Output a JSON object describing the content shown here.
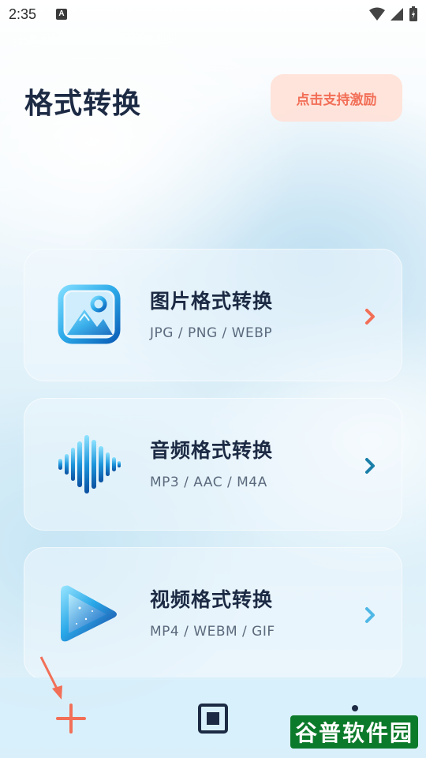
{
  "status_bar": {
    "time": "2:35",
    "notification_badge": "A"
  },
  "header": {
    "title": "格式转换",
    "support_button_label": "点击支持激励"
  },
  "cards": [
    {
      "title": "图片格式转换",
      "subtitle": "JPG / PNG / WEBP",
      "icon": "image-icon",
      "chevron_color": "#f26f57"
    },
    {
      "title": "音频格式转换",
      "subtitle": "MP3 / AAC / M4A",
      "icon": "audio-wave-icon",
      "chevron_color": "#1a7fa8"
    },
    {
      "title": "视频格式转换",
      "subtitle": "MP4 / WEBM / GIF",
      "icon": "video-play-icon",
      "chevron_color": "#4fb8e6"
    }
  ],
  "bottom_bar": {
    "items": [
      "plus-icon",
      "stop-square-icon",
      "more-dots-icon"
    ]
  },
  "watermark": "谷普软件园",
  "colors": {
    "accent_red": "#f26f57",
    "title_dark": "#1c2a44",
    "icon_blue": "#2aa8e8"
  }
}
